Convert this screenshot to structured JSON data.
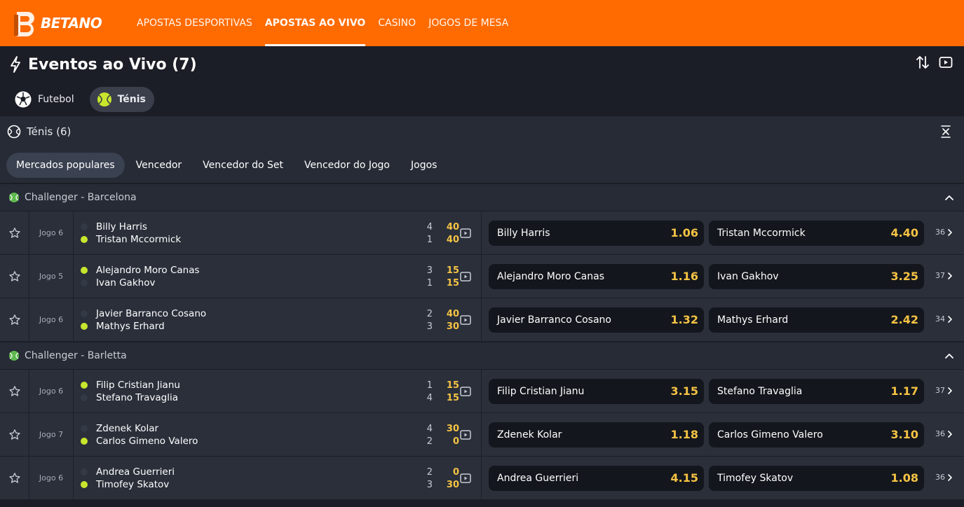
{
  "brand": {
    "name": "BETANO",
    "accent": "#ff6b00",
    "odds_color": "#f6c344",
    "serve_color": "#c8e62d"
  },
  "nav": [
    {
      "label": "APOSTAS DESPORTIVAS",
      "active": false
    },
    {
      "label": "APOSTAS AO VIVO",
      "active": true
    },
    {
      "label": "CASINO",
      "active": false
    },
    {
      "label": "JOGOS DE MESA",
      "active": false
    }
  ],
  "page_title": "Eventos ao Vivo (7)",
  "sport_tabs": [
    {
      "label": "Futebol",
      "icon": "soccer-ball-icon",
      "active": false
    },
    {
      "label": "Ténis",
      "icon": "tennis-ball-icon",
      "active": true
    }
  ],
  "section": {
    "title": "Ténis (6)"
  },
  "market_tabs": [
    {
      "label": "Mercados populares",
      "active": true
    },
    {
      "label": "Vencedor",
      "active": false
    },
    {
      "label": "Vencedor do Set",
      "active": false
    },
    {
      "label": "Vencedor do Jogo",
      "active": false
    },
    {
      "label": "Jogos",
      "active": false
    }
  ],
  "leagues": [
    {
      "name": "Challenger - Barcelona",
      "matches": [
        {
          "game": "Jogo 6",
          "p1": {
            "name": "Billy Harris",
            "serving": false,
            "sets": "4",
            "pts": "40"
          },
          "p2": {
            "name": "Tristan Mccormick",
            "serving": true,
            "sets": "1",
            "pts": "40"
          },
          "odds": [
            {
              "name": "Billy Harris",
              "value": "1.06"
            },
            {
              "name": "Tristan Mccormick",
              "value": "4.40"
            }
          ],
          "more": "36"
        },
        {
          "game": "Jogo 5",
          "p1": {
            "name": "Alejandro Moro Canas",
            "serving": true,
            "sets": "3",
            "pts": "15"
          },
          "p2": {
            "name": "Ivan Gakhov",
            "serving": false,
            "sets": "1",
            "pts": "15"
          },
          "odds": [
            {
              "name": "Alejandro Moro Canas",
              "value": "1.16"
            },
            {
              "name": "Ivan Gakhov",
              "value": "3.25"
            }
          ],
          "more": "37"
        },
        {
          "game": "Jogo 6",
          "p1": {
            "name": "Javier Barranco Cosano",
            "serving": false,
            "sets": "2",
            "pts": "40"
          },
          "p2": {
            "name": "Mathys Erhard",
            "serving": true,
            "sets": "3",
            "pts": "30"
          },
          "odds": [
            {
              "name": "Javier Barranco Cosano",
              "value": "1.32"
            },
            {
              "name": "Mathys Erhard",
              "value": "2.42"
            }
          ],
          "more": "34"
        }
      ]
    },
    {
      "name": "Challenger - Barletta",
      "matches": [
        {
          "game": "Jogo 6",
          "p1": {
            "name": "Filip Cristian Jianu",
            "serving": true,
            "sets": "1",
            "pts": "15"
          },
          "p2": {
            "name": "Stefano Travaglia",
            "serving": false,
            "sets": "4",
            "pts": "15"
          },
          "odds": [
            {
              "name": "Filip Cristian Jianu",
              "value": "3.15"
            },
            {
              "name": "Stefano Travaglia",
              "value": "1.17"
            }
          ],
          "more": "37"
        },
        {
          "game": "Jogo 7",
          "p1": {
            "name": "Zdenek Kolar",
            "serving": false,
            "sets": "4",
            "pts": "30"
          },
          "p2": {
            "name": "Carlos Gimeno Valero",
            "serving": true,
            "sets": "2",
            "pts": "0"
          },
          "odds": [
            {
              "name": "Zdenek Kolar",
              "value": "1.18"
            },
            {
              "name": "Carlos Gimeno Valero",
              "value": "3.10"
            }
          ],
          "more": "36"
        },
        {
          "game": "Jogo 6",
          "p1": {
            "name": "Andrea Guerrieri",
            "serving": false,
            "sets": "2",
            "pts": "0"
          },
          "p2": {
            "name": "Timofey Skatov",
            "serving": true,
            "sets": "3",
            "pts": "30"
          },
          "odds": [
            {
              "name": "Andrea Guerrieri",
              "value": "4.15"
            },
            {
              "name": "Timofey Skatov",
              "value": "1.08"
            }
          ],
          "more": "36"
        }
      ]
    }
  ]
}
